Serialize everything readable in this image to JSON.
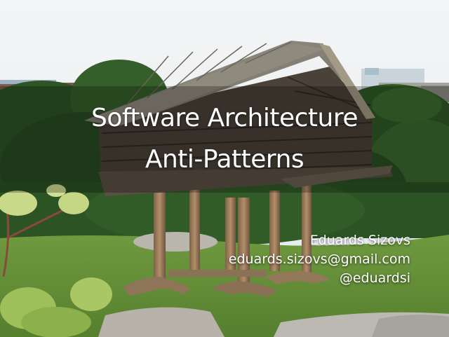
{
  "slide": {
    "title_line_1": "Software Architecture",
    "title_line_2": "Anti-Patterns",
    "author_name": "Eduards Sizovs",
    "author_email": "eduards.sizovs@gmail.com",
    "author_handle": "@eduardsi"
  },
  "colors": {
    "sky": "#eef1f4",
    "foliage": "#2f5a26",
    "grass": "#7da64a",
    "wood_roof": "#8b8578",
    "wood_wall": "#4a4238",
    "stilts": "#9a7b5c",
    "rock": "#b9b6ae",
    "title_text": "#ffffff"
  },
  "icons": {
    "background_photo": "log-storehouse-on-stilts-image"
  }
}
